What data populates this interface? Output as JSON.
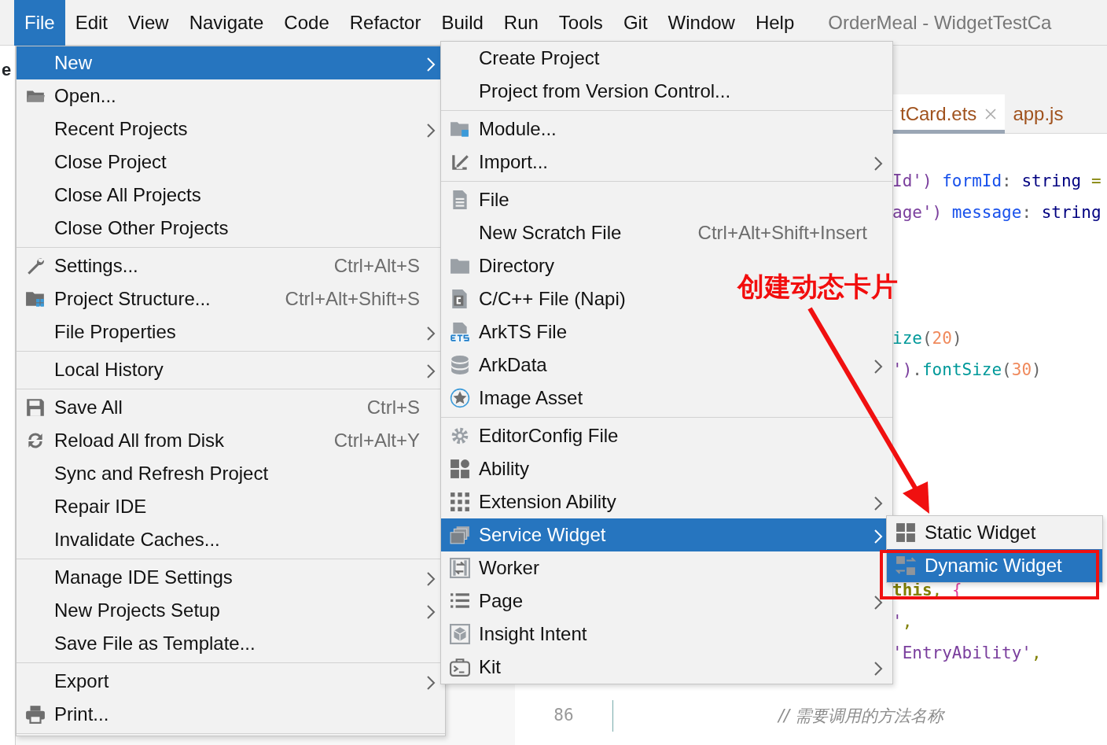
{
  "menubar": {
    "items": [
      {
        "label": "File",
        "selected": true
      },
      {
        "label": "Edit",
        "selected": false
      },
      {
        "label": "View",
        "selected": false
      },
      {
        "label": "Navigate",
        "selected": false
      },
      {
        "label": "Code",
        "selected": false
      },
      {
        "label": "Refactor",
        "selected": false
      },
      {
        "label": "Build",
        "selected": false
      },
      {
        "label": "Run",
        "selected": false
      },
      {
        "label": "Tools",
        "selected": false
      },
      {
        "label": "Git",
        "selected": false
      },
      {
        "label": "Window",
        "selected": false
      },
      {
        "label": "Help",
        "selected": false
      }
    ],
    "title": "OrderMeal - WidgetTestCa"
  },
  "side_panel": {
    "header_text": "e"
  },
  "editor": {
    "tabs": [
      {
        "label": "tCard.ets",
        "selected": true,
        "closable": true
      },
      {
        "label": "app.js",
        "selected": false,
        "closable": false
      }
    ],
    "lines": [
      {
        "kind": "cut",
        "segments": [
          {
            "kind": "string",
            "text": "Id')"
          },
          {
            "kind": "field",
            "text": " formId"
          },
          {
            "kind": "punct",
            "text": ":"
          },
          {
            "kind": "type",
            "text": " string"
          },
          {
            "kind": "op",
            "text": " ="
          }
        ]
      },
      {
        "kind": "cut",
        "segments": [
          {
            "kind": "string",
            "text": "age')"
          },
          {
            "kind": "field",
            "text": " message"
          },
          {
            "kind": "punct",
            "text": ":"
          },
          {
            "kind": "type",
            "text": " string"
          }
        ]
      },
      {
        "kind": "blank"
      },
      {
        "kind": "blank"
      },
      {
        "kind": "blank"
      },
      {
        "kind": "cut",
        "segments": [
          {
            "kind": "method",
            "text": "ize"
          },
          {
            "kind": "punct",
            "text": "("
          },
          {
            "kind": "number",
            "text": "20"
          },
          {
            "kind": "punct",
            "text": ")"
          }
        ]
      },
      {
        "kind": "cut",
        "segments": [
          {
            "kind": "string",
            "text": "')"
          },
          {
            "kind": "punct",
            "text": "."
          },
          {
            "kind": "method",
            "text": "fontSize"
          },
          {
            "kind": "punct",
            "text": "("
          },
          {
            "kind": "number",
            "text": "30"
          },
          {
            "kind": "punct",
            "text": ")"
          }
        ]
      },
      {
        "kind": "blank"
      },
      {
        "kind": "blank"
      },
      {
        "kind": "blank"
      },
      {
        "kind": "blank"
      },
      {
        "kind": "blank"
      },
      {
        "kind": "blank"
      },
      {
        "kind": "cut",
        "segments": [
          {
            "kind": "keyword",
            "text": "this"
          },
          {
            "kind": "op",
            "text": ","
          },
          {
            "kind": "brace",
            "text": " {"
          }
        ]
      },
      {
        "kind": "cut",
        "segments": [
          {
            "kind": "string",
            "text": "'"
          },
          {
            "kind": "op",
            "text": ","
          }
        ]
      },
      {
        "kind": "cut",
        "segments": [
          {
            "kind": "string",
            "text": "'EntryAbility'"
          },
          {
            "kind": "op",
            "text": ","
          }
        ]
      },
      {
        "kind": "blank"
      },
      {
        "kind": "numbered",
        "number": "86",
        "segments": [
          {
            "kind": "comment",
            "text": "// 需要调用的方法名称"
          }
        ]
      }
    ]
  },
  "file_menu": {
    "items": [
      {
        "kind": "item",
        "label": "New",
        "submenu": true,
        "selected": true
      },
      {
        "kind": "item",
        "label": "Open...",
        "submenu": false,
        "selected": false
      },
      {
        "kind": "item",
        "label": "Recent Projects",
        "submenu": true,
        "selected": false
      },
      {
        "kind": "item",
        "label": "Close Project",
        "submenu": false,
        "selected": false
      },
      {
        "kind": "item",
        "label": "Close All Projects",
        "submenu": false,
        "selected": false
      },
      {
        "kind": "item",
        "label": "Close Other Projects",
        "submenu": false,
        "selected": false
      },
      {
        "kind": "separator"
      },
      {
        "kind": "item",
        "label": "Settings...",
        "shortcut": "Ctrl+Alt+S",
        "submenu": false,
        "selected": false
      },
      {
        "kind": "item",
        "label": "Project Structure...",
        "shortcut": "Ctrl+Alt+Shift+S",
        "submenu": false,
        "selected": false
      },
      {
        "kind": "item",
        "label": "File Properties",
        "submenu": true,
        "selected": false
      },
      {
        "kind": "separator"
      },
      {
        "kind": "item",
        "label": "Local History",
        "submenu": true,
        "selected": false
      },
      {
        "kind": "separator"
      },
      {
        "kind": "item",
        "label": "Save All",
        "shortcut": "Ctrl+S",
        "submenu": false,
        "selected": false
      },
      {
        "kind": "item",
        "label": "Reload All from Disk",
        "shortcut": "Ctrl+Alt+Y",
        "submenu": false,
        "selected": false
      },
      {
        "kind": "item",
        "label": "Sync and Refresh Project",
        "submenu": false,
        "selected": false
      },
      {
        "kind": "item",
        "label": "Repair IDE",
        "submenu": false,
        "selected": false
      },
      {
        "kind": "item",
        "label": "Invalidate Caches...",
        "submenu": false,
        "selected": false
      },
      {
        "kind": "separator"
      },
      {
        "kind": "item",
        "label": "Manage IDE Settings",
        "submenu": true,
        "selected": false
      },
      {
        "kind": "item",
        "label": "New Projects Setup",
        "submenu": true,
        "selected": false
      },
      {
        "kind": "item",
        "label": "Save File as Template...",
        "submenu": false,
        "selected": false
      },
      {
        "kind": "separator"
      },
      {
        "kind": "item",
        "label": "Export",
        "submenu": true,
        "selected": false
      },
      {
        "kind": "item",
        "label": "Print...",
        "submenu": false,
        "selected": false
      },
      {
        "kind": "separator"
      }
    ]
  },
  "new_menu": {
    "items": [
      {
        "kind": "item",
        "label": "Create Project",
        "submenu": false,
        "selected": false
      },
      {
        "kind": "item",
        "label": "Project from Version Control...",
        "submenu": false,
        "selected": false
      },
      {
        "kind": "separator"
      },
      {
        "kind": "item",
        "label": "Module...",
        "submenu": false,
        "selected": false
      },
      {
        "kind": "item",
        "label": "Import...",
        "submenu": true,
        "selected": false
      },
      {
        "kind": "separator"
      },
      {
        "kind": "item",
        "label": "File",
        "submenu": false,
        "selected": false
      },
      {
        "kind": "item",
        "label": "New Scratch File",
        "shortcut": "Ctrl+Alt+Shift+Insert",
        "submenu": false,
        "selected": false
      },
      {
        "kind": "item",
        "label": "Directory",
        "submenu": false,
        "selected": false
      },
      {
        "kind": "item",
        "label": "C/C++ File (Napi)",
        "submenu": false,
        "selected": false
      },
      {
        "kind": "item",
        "label": "ArkTS File",
        "submenu": false,
        "selected": false
      },
      {
        "kind": "item",
        "label": "ArkData",
        "submenu": true,
        "selected": false
      },
      {
        "kind": "item",
        "label": "Image Asset",
        "submenu": false,
        "selected": false
      },
      {
        "kind": "separator"
      },
      {
        "kind": "item",
        "label": "EditorConfig File",
        "submenu": false,
        "selected": false
      },
      {
        "kind": "item",
        "label": "Ability",
        "submenu": false,
        "selected": false
      },
      {
        "kind": "item",
        "label": "Extension Ability",
        "submenu": true,
        "selected": false
      },
      {
        "kind": "item",
        "label": "Service Widget",
        "submenu": true,
        "selected": true
      },
      {
        "kind": "item",
        "label": "Worker",
        "submenu": false,
        "selected": false
      },
      {
        "kind": "item",
        "label": "Page",
        "submenu": true,
        "selected": false
      },
      {
        "kind": "item",
        "label": "Insight Intent",
        "submenu": false,
        "selected": false
      },
      {
        "kind": "item",
        "label": "Kit",
        "submenu": true,
        "selected": false
      }
    ]
  },
  "widget_menu": {
    "items": [
      {
        "kind": "item",
        "label": "Static Widget",
        "submenu": false,
        "selected": false
      },
      {
        "kind": "item",
        "label": "Dynamic Widget",
        "submenu": false,
        "selected": true
      }
    ]
  },
  "annotation": {
    "label": "创建动态卡片"
  }
}
